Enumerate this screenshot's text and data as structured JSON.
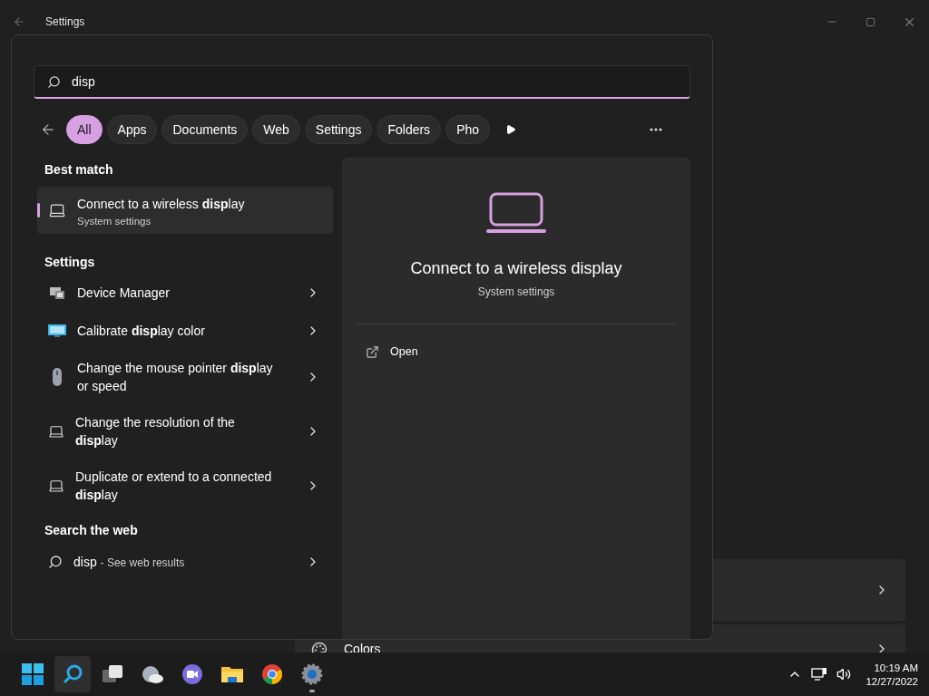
{
  "window": {
    "title": "Settings"
  },
  "background_rows": [
    {
      "label": ""
    },
    {
      "label": "Colors"
    }
  ],
  "search": {
    "value": "disp"
  },
  "filters": [
    {
      "label": "All",
      "selected": true
    },
    {
      "label": "Apps",
      "selected": false
    },
    {
      "label": "Documents",
      "selected": false
    },
    {
      "label": "Web",
      "selected": false
    },
    {
      "label": "Settings",
      "selected": false
    },
    {
      "label": "Folders",
      "selected": false
    },
    {
      "label": "Pho",
      "selected": false
    }
  ],
  "best_match": {
    "heading": "Best match",
    "title": "Connect to a wireless **disp**lay",
    "subtitle": "System settings",
    "selected": true
  },
  "settings": {
    "heading": "Settings",
    "items": [
      {
        "kind": "device",
        "title": "Device Manager"
      },
      {
        "kind": "monitor",
        "title": "Calibrate **disp**lay color"
      },
      {
        "kind": "mouse",
        "title": "Change the mouse pointer **disp**lay or speed"
      },
      {
        "kind": "laptop",
        "title": "Change the resolution of the **disp**lay"
      },
      {
        "kind": "laptop",
        "title": "Duplicate or extend to a connected **disp**lay"
      }
    ]
  },
  "web": {
    "heading": "Search the web",
    "query": "disp",
    "suffix": "- See web results"
  },
  "preview": {
    "title": "Connect to a wireless display",
    "subtitle": "System settings",
    "actions": [
      {
        "label": "Open"
      }
    ]
  },
  "taskbar": {
    "apps": [
      {
        "kind": "start",
        "selected": false,
        "running": false
      },
      {
        "kind": "search",
        "selected": true,
        "running": false
      },
      {
        "kind": "taskview",
        "selected": false,
        "running": false
      },
      {
        "kind": "weather",
        "selected": false,
        "running": false
      },
      {
        "kind": "chat",
        "selected": false,
        "running": false
      },
      {
        "kind": "explorer",
        "selected": false,
        "running": false
      },
      {
        "kind": "chrome",
        "selected": false,
        "running": false
      },
      {
        "kind": "settings",
        "selected": false,
        "running": true
      }
    ],
    "time": "10:19 AM",
    "date": "12/27/2022"
  }
}
